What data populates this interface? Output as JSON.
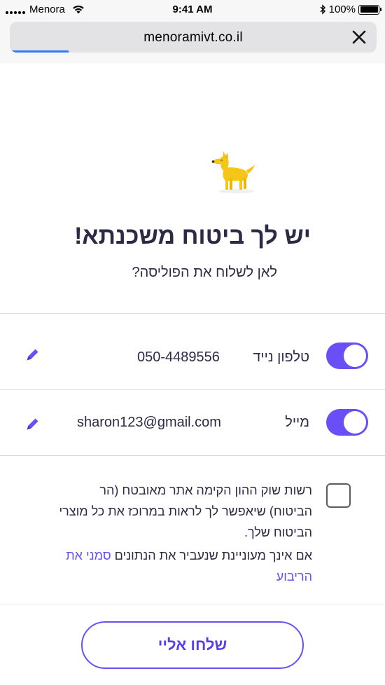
{
  "status_bar": {
    "carrier": "Menora",
    "time": "9:41 AM",
    "battery": "100%",
    "icons": [
      "signal-icon",
      "wifi-icon",
      "bluetooth-icon",
      "battery-icon"
    ]
  },
  "browser": {
    "url": "menoramivt.co.il",
    "close_icon": "close-icon",
    "load_progress": 0.16,
    "progress_color": "#3478f6"
  },
  "hero": {
    "illustration": "dog-icon",
    "title": "יש לך ביטוח משכנתא!",
    "subtitle": "לאן לשלוח את הפוליסה?"
  },
  "contacts": [
    {
      "label": "טלפון נייד",
      "value": "050-4489556",
      "enabled": true,
      "edit_icon": "pencil-icon"
    },
    {
      "label": "מייל",
      "value": "sharon123@gmail.com",
      "enabled": true,
      "edit_icon": "pencil-icon"
    }
  ],
  "consent": {
    "checked": false,
    "text": "רשות שוק ההון הקימה אתר מאובטח (הר הביטוח) שיאפשר לך לראות במרוכז את כל מוצרי הביטוח שלך.",
    "note_text": "אם אינך מעוניינת שנעביר את הנתונים ",
    "note_link": "סמני את הריבוע"
  },
  "actions": {
    "send_label": "שלחו אליי"
  },
  "colors": {
    "accent": "#6a4ff6",
    "text": "#2c2b45",
    "divider": "#dcdce0",
    "dog": "#f5c518"
  }
}
